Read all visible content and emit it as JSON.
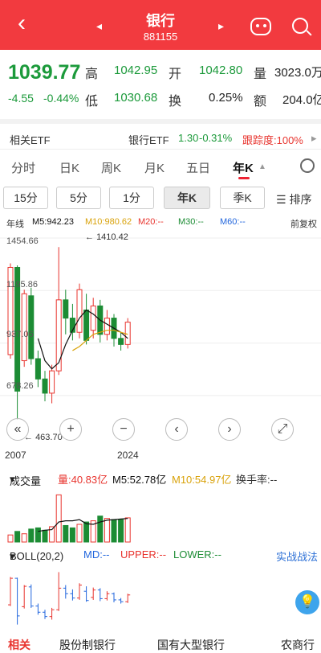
{
  "header": {
    "title": "银行",
    "code": "881155",
    "bg": "#f23a3f"
  },
  "quote": {
    "price": "1039.77",
    "change": "-4.55",
    "change_pct": "-0.44%",
    "high_label": "高",
    "high": "1042.95",
    "open_label": "开",
    "open": "1042.80",
    "volume_label": "量",
    "volume": "3023.0万",
    "low_label": "低",
    "low": "1030.68",
    "turnover_label": "换",
    "turnover": "0.25%",
    "amount_label": "额",
    "amount": "204.0亿"
  },
  "etf": {
    "label": "相关ETF",
    "name": "银行ETF",
    "price": "1.30",
    "pct": "-0.31%",
    "track": "跟踪度:100%",
    "arrow": "▸"
  },
  "tabs": [
    "分时",
    "日K",
    "周K",
    "月K",
    "五日",
    "年K"
  ],
  "active_tab": "年K",
  "sub_buttons": [
    "15分",
    "5分",
    "1分",
    "年K",
    "季K"
  ],
  "sort_label": "☰ 排序",
  "ma": {
    "label": "年线",
    "m5": "M5:942.23",
    "m10": "M10:980.62",
    "m20": "M20:--",
    "m30": "M30:--",
    "m60": "M60:--",
    "adj": "前复权"
  },
  "chart_data": {
    "type": "candlestick",
    "y_labels": [
      "1454.66",
      "1195.86",
      "937.06",
      "678.26",
      "463.70"
    ],
    "high_annotation": "1410.42",
    "low_annotation": "463.70",
    "x_labels": [
      "2007",
      "2024"
    ],
    "candles": [
      {
        "o": 880,
        "c": 1310,
        "h": 1330,
        "l": 860,
        "up": true
      },
      {
        "o": 1310,
        "c": 700,
        "h": 1320,
        "l": 560,
        "up": false
      },
      {
        "o": 850,
        "c": 1180,
        "h": 1200,
        "l": 820,
        "up": true
      },
      {
        "o": 1170,
        "c": 860,
        "h": 1210,
        "l": 830,
        "up": false
      },
      {
        "o": 860,
        "c": 760,
        "h": 900,
        "l": 720,
        "up": false
      },
      {
        "o": 760,
        "c": 690,
        "h": 800,
        "l": 650,
        "up": false
      },
      {
        "o": 690,
        "c": 800,
        "h": 830,
        "l": 640,
        "up": true
      },
      {
        "o": 800,
        "c": 1150,
        "h": 1410,
        "l": 780,
        "up": true
      },
      {
        "o": 1150,
        "c": 1060,
        "h": 1200,
        "l": 980,
        "up": false
      },
      {
        "o": 1060,
        "c": 990,
        "h": 1130,
        "l": 950,
        "up": false
      },
      {
        "o": 990,
        "c": 1200,
        "h": 1230,
        "l": 960,
        "up": true
      },
      {
        "o": 1100,
        "c": 950,
        "h": 1180,
        "l": 930,
        "up": false
      },
      {
        "o": 1000,
        "c": 1120,
        "h": 1160,
        "l": 960,
        "up": true
      },
      {
        "o": 1120,
        "c": 980,
        "h": 1150,
        "l": 940,
        "up": false
      },
      {
        "o": 980,
        "c": 1060,
        "h": 1100,
        "l": 950,
        "up": true
      },
      {
        "o": 1060,
        "c": 960,
        "h": 1080,
        "l": 920,
        "up": false
      },
      {
        "o": 960,
        "c": 930,
        "h": 990,
        "l": 900,
        "up": false
      },
      {
        "o": 930,
        "c": 1040,
        "h": 1060,
        "l": 910,
        "up": true
      }
    ],
    "ma5": [
      null,
      null,
      null,
      null,
      960,
      850,
      810,
      840,
      930,
      1000,
      1060,
      1100,
      1080,
      1050,
      1030,
      1010,
      990,
      960
    ],
    "ma10": [
      null,
      null,
      null,
      null,
      null,
      null,
      null,
      null,
      null,
      900,
      920,
      950,
      980,
      990,
      1000,
      1000,
      990,
      980
    ],
    "volume_values": [
      12,
      18,
      14,
      22,
      24,
      20,
      26,
      80,
      28,
      24,
      30,
      34,
      36,
      44,
      40,
      38,
      38,
      41
    ],
    "volume_ma5": [
      null,
      null,
      null,
      null,
      18,
      20,
      21,
      34,
      36,
      36,
      38,
      31,
      30,
      34,
      37,
      38,
      39,
      40
    ]
  },
  "volume": {
    "label": "成交量",
    "caret": "▾",
    "vol": "量:40.83亿",
    "m5": "M5:52.78亿",
    "m10": "M10:54.97亿",
    "turnover": "换手率:--"
  },
  "boll": {
    "label": "BOLL(20,2)",
    "caret": "▾",
    "md": "MD:--",
    "upper": "UPPER:--",
    "lower": "LOWER:--",
    "link": "实战战法"
  },
  "bottom": [
    "相关",
    "股份制银行",
    "国有大型银行",
    "农商行"
  ],
  "colors": {
    "up": "#e8342e",
    "down": "#1c8c34",
    "ma5": "#111111",
    "ma10": "#d9a20a",
    "ma20": "#e8342e",
    "ma30": "#1c8c34",
    "ma60": "#2266dd",
    "accent": "#2b6fd6"
  }
}
